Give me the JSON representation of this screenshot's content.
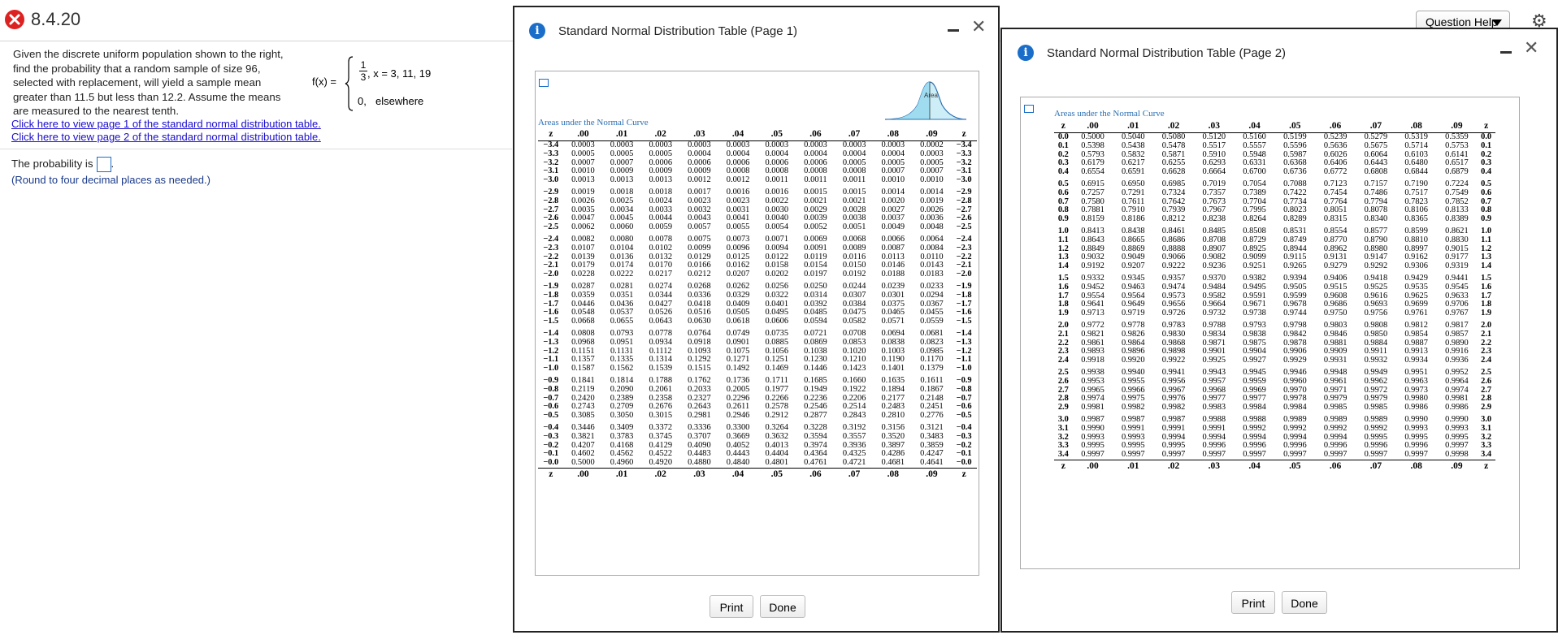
{
  "header": {
    "question_number": "8.4.20",
    "question_help_label": "Question Help"
  },
  "question": {
    "text": "Given the discrete uniform population shown to the right, find the probability that a random sample of size 96, selected with replacement, will yield a sample mean greater than 11.5 but less than 12.2. Assume the means are measured to the nearest tenth.",
    "fx_label": "f(x) =",
    "frac_num": "1",
    "frac_den": "3",
    "case1_condition": ", x = 3, 11, 19",
    "case2_value": "0,",
    "case2_condition": "elsewhere",
    "link1": "Click here to view page 1 of the standard normal distribution table.",
    "link2": "Click here to view page 2 of the standard normal distribution table.",
    "answer_prefix": "The probability is",
    "answer_suffix": ".",
    "round_note": "(Round to four decimal places as needed.)"
  },
  "dialog1": {
    "title": "Standard Normal Distribution Table (Page 1)",
    "areas_label": "Areas under the Normal Curve",
    "curve_label": "Area",
    "print_label": "Print",
    "done_label": "Done"
  },
  "dialog2": {
    "title": "Standard Normal Distribution Table (Page 2)",
    "areas_label": "Areas under the Normal Curve",
    "print_label": "Print",
    "done_label": "Done"
  },
  "table_cols": [
    "z",
    ".00",
    ".01",
    ".02",
    ".03",
    ".04",
    ".05",
    ".06",
    ".07",
    ".08",
    ".09",
    "z"
  ],
  "table_page1": [
    [
      "−3.4",
      "0.0003",
      "0.0003",
      "0.0003",
      "0.0003",
      "0.0003",
      "0.0003",
      "0.0003",
      "0.0003",
      "0.0003",
      "0.0002",
      "−3.4"
    ],
    [
      "−3.3",
      "0.0005",
      "0.0005",
      "0.0005",
      "0.0004",
      "0.0004",
      "0.0004",
      "0.0004",
      "0.0004",
      "0.0004",
      "0.0003",
      "−3.3"
    ],
    [
      "−3.2",
      "0.0007",
      "0.0007",
      "0.0006",
      "0.0006",
      "0.0006",
      "0.0006",
      "0.0006",
      "0.0005",
      "0.0005",
      "0.0005",
      "−3.2"
    ],
    [
      "−3.1",
      "0.0010",
      "0.0009",
      "0.0009",
      "0.0009",
      "0.0008",
      "0.0008",
      "0.0008",
      "0.0008",
      "0.0007",
      "0.0007",
      "−3.1"
    ],
    [
      "−3.0",
      "0.0013",
      "0.0013",
      "0.0013",
      "0.0012",
      "0.0012",
      "0.0011",
      "0.0011",
      "0.0011",
      "0.0010",
      "0.0010",
      "−3.0"
    ],
    [
      "−2.9",
      "0.0019",
      "0.0018",
      "0.0018",
      "0.0017",
      "0.0016",
      "0.0016",
      "0.0015",
      "0.0015",
      "0.0014",
      "0.0014",
      "−2.9"
    ],
    [
      "−2.8",
      "0.0026",
      "0.0025",
      "0.0024",
      "0.0023",
      "0.0023",
      "0.0022",
      "0.0021",
      "0.0021",
      "0.0020",
      "0.0019",
      "−2.8"
    ],
    [
      "−2.7",
      "0.0035",
      "0.0034",
      "0.0033",
      "0.0032",
      "0.0031",
      "0.0030",
      "0.0029",
      "0.0028",
      "0.0027",
      "0.0026",
      "−2.7"
    ],
    [
      "−2.6",
      "0.0047",
      "0.0045",
      "0.0044",
      "0.0043",
      "0.0041",
      "0.0040",
      "0.0039",
      "0.0038",
      "0.0037",
      "0.0036",
      "−2.6"
    ],
    [
      "−2.5",
      "0.0062",
      "0.0060",
      "0.0059",
      "0.0057",
      "0.0055",
      "0.0054",
      "0.0052",
      "0.0051",
      "0.0049",
      "0.0048",
      "−2.5"
    ],
    [
      "−2.4",
      "0.0082",
      "0.0080",
      "0.0078",
      "0.0075",
      "0.0073",
      "0.0071",
      "0.0069",
      "0.0068",
      "0.0066",
      "0.0064",
      "−2.4"
    ],
    [
      "−2.3",
      "0.0107",
      "0.0104",
      "0.0102",
      "0.0099",
      "0.0096",
      "0.0094",
      "0.0091",
      "0.0089",
      "0.0087",
      "0.0084",
      "−2.3"
    ],
    [
      "−2.2",
      "0.0139",
      "0.0136",
      "0.0132",
      "0.0129",
      "0.0125",
      "0.0122",
      "0.0119",
      "0.0116",
      "0.0113",
      "0.0110",
      "−2.2"
    ],
    [
      "−2.1",
      "0.0179",
      "0.0174",
      "0.0170",
      "0.0166",
      "0.0162",
      "0.0158",
      "0.0154",
      "0.0150",
      "0.0146",
      "0.0143",
      "−2.1"
    ],
    [
      "−2.0",
      "0.0228",
      "0.0222",
      "0.0217",
      "0.0212",
      "0.0207",
      "0.0202",
      "0.0197",
      "0.0192",
      "0.0188",
      "0.0183",
      "−2.0"
    ],
    [
      "−1.9",
      "0.0287",
      "0.0281",
      "0.0274",
      "0.0268",
      "0.0262",
      "0.0256",
      "0.0250",
      "0.0244",
      "0.0239",
      "0.0233",
      "−1.9"
    ],
    [
      "−1.8",
      "0.0359",
      "0.0351",
      "0.0344",
      "0.0336",
      "0.0329",
      "0.0322",
      "0.0314",
      "0.0307",
      "0.0301",
      "0.0294",
      "−1.8"
    ],
    [
      "−1.7",
      "0.0446",
      "0.0436",
      "0.0427",
      "0.0418",
      "0.0409",
      "0.0401",
      "0.0392",
      "0.0384",
      "0.0375",
      "0.0367",
      "−1.7"
    ],
    [
      "−1.6",
      "0.0548",
      "0.0537",
      "0.0526",
      "0.0516",
      "0.0505",
      "0.0495",
      "0.0485",
      "0.0475",
      "0.0465",
      "0.0455",
      "−1.6"
    ],
    [
      "−1.5",
      "0.0668",
      "0.0655",
      "0.0643",
      "0.0630",
      "0.0618",
      "0.0606",
      "0.0594",
      "0.0582",
      "0.0571",
      "0.0559",
      "−1.5"
    ],
    [
      "−1.4",
      "0.0808",
      "0.0793",
      "0.0778",
      "0.0764",
      "0.0749",
      "0.0735",
      "0.0721",
      "0.0708",
      "0.0694",
      "0.0681",
      "−1.4"
    ],
    [
      "−1.3",
      "0.0968",
      "0.0951",
      "0.0934",
      "0.0918",
      "0.0901",
      "0.0885",
      "0.0869",
      "0.0853",
      "0.0838",
      "0.0823",
      "−1.3"
    ],
    [
      "−1.2",
      "0.1151",
      "0.1131",
      "0.1112",
      "0.1093",
      "0.1075",
      "0.1056",
      "0.1038",
      "0.1020",
      "0.1003",
      "0.0985",
      "−1.2"
    ],
    [
      "−1.1",
      "0.1357",
      "0.1335",
      "0.1314",
      "0.1292",
      "0.1271",
      "0.1251",
      "0.1230",
      "0.1210",
      "0.1190",
      "0.1170",
      "−1.1"
    ],
    [
      "−1.0",
      "0.1587",
      "0.1562",
      "0.1539",
      "0.1515",
      "0.1492",
      "0.1469",
      "0.1446",
      "0.1423",
      "0.1401",
      "0.1379",
      "−1.0"
    ],
    [
      "−0.9",
      "0.1841",
      "0.1814",
      "0.1788",
      "0.1762",
      "0.1736",
      "0.1711",
      "0.1685",
      "0.1660",
      "0.1635",
      "0.1611",
      "−0.9"
    ],
    [
      "−0.8",
      "0.2119",
      "0.2090",
      "0.2061",
      "0.2033",
      "0.2005",
      "0.1977",
      "0.1949",
      "0.1922",
      "0.1894",
      "0.1867",
      "−0.8"
    ],
    [
      "−0.7",
      "0.2420",
      "0.2389",
      "0.2358",
      "0.2327",
      "0.2296",
      "0.2266",
      "0.2236",
      "0.2206",
      "0.2177",
      "0.2148",
      "−0.7"
    ],
    [
      "−0.6",
      "0.2743",
      "0.2709",
      "0.2676",
      "0.2643",
      "0.2611",
      "0.2578",
      "0.2546",
      "0.2514",
      "0.2483",
      "0.2451",
      "−0.6"
    ],
    [
      "−0.5",
      "0.3085",
      "0.3050",
      "0.3015",
      "0.2981",
      "0.2946",
      "0.2912",
      "0.2877",
      "0.2843",
      "0.2810",
      "0.2776",
      "−0.5"
    ],
    [
      "−0.4",
      "0.3446",
      "0.3409",
      "0.3372",
      "0.3336",
      "0.3300",
      "0.3264",
      "0.3228",
      "0.3192",
      "0.3156",
      "0.3121",
      "−0.4"
    ],
    [
      "−0.3",
      "0.3821",
      "0.3783",
      "0.3745",
      "0.3707",
      "0.3669",
      "0.3632",
      "0.3594",
      "0.3557",
      "0.3520",
      "0.3483",
      "−0.3"
    ],
    [
      "−0.2",
      "0.4207",
      "0.4168",
      "0.4129",
      "0.4090",
      "0.4052",
      "0.4013",
      "0.3974",
      "0.3936",
      "0.3897",
      "0.3859",
      "−0.2"
    ],
    [
      "−0.1",
      "0.4602",
      "0.4562",
      "0.4522",
      "0.4483",
      "0.4443",
      "0.4404",
      "0.4364",
      "0.4325",
      "0.4286",
      "0.4247",
      "−0.1"
    ],
    [
      "−0.0",
      "0.5000",
      "0.4960",
      "0.4920",
      "0.4880",
      "0.4840",
      "0.4801",
      "0.4761",
      "0.4721",
      "0.4681",
      "0.4641",
      "−0.0"
    ]
  ],
  "table_page2": [
    [
      "0.0",
      "0.5000",
      "0.5040",
      "0.5080",
      "0.5120",
      "0.5160",
      "0.5199",
      "0.5239",
      "0.5279",
      "0.5319",
      "0.5359",
      "0.0"
    ],
    [
      "0.1",
      "0.5398",
      "0.5438",
      "0.5478",
      "0.5517",
      "0.5557",
      "0.5596",
      "0.5636",
      "0.5675",
      "0.5714",
      "0.5753",
      "0.1"
    ],
    [
      "0.2",
      "0.5793",
      "0.5832",
      "0.5871",
      "0.5910",
      "0.5948",
      "0.5987",
      "0.6026",
      "0.6064",
      "0.6103",
      "0.6141",
      "0.2"
    ],
    [
      "0.3",
      "0.6179",
      "0.6217",
      "0.6255",
      "0.6293",
      "0.6331",
      "0.6368",
      "0.6406",
      "0.6443",
      "0.6480",
      "0.6517",
      "0.3"
    ],
    [
      "0.4",
      "0.6554",
      "0.6591",
      "0.6628",
      "0.6664",
      "0.6700",
      "0.6736",
      "0.6772",
      "0.6808",
      "0.6844",
      "0.6879",
      "0.4"
    ],
    [
      "0.5",
      "0.6915",
      "0.6950",
      "0.6985",
      "0.7019",
      "0.7054",
      "0.7088",
      "0.7123",
      "0.7157",
      "0.7190",
      "0.7224",
      "0.5"
    ],
    [
      "0.6",
      "0.7257",
      "0.7291",
      "0.7324",
      "0.7357",
      "0.7389",
      "0.7422",
      "0.7454",
      "0.7486",
      "0.7517",
      "0.7549",
      "0.6"
    ],
    [
      "0.7",
      "0.7580",
      "0.7611",
      "0.7642",
      "0.7673",
      "0.7704",
      "0.7734",
      "0.7764",
      "0.7794",
      "0.7823",
      "0.7852",
      "0.7"
    ],
    [
      "0.8",
      "0.7881",
      "0.7910",
      "0.7939",
      "0.7967",
      "0.7995",
      "0.8023",
      "0.8051",
      "0.8078",
      "0.8106",
      "0.8133",
      "0.8"
    ],
    [
      "0.9",
      "0.8159",
      "0.8186",
      "0.8212",
      "0.8238",
      "0.8264",
      "0.8289",
      "0.8315",
      "0.8340",
      "0.8365",
      "0.8389",
      "0.9"
    ],
    [
      "1.0",
      "0.8413",
      "0.8438",
      "0.8461",
      "0.8485",
      "0.8508",
      "0.8531",
      "0.8554",
      "0.8577",
      "0.8599",
      "0.8621",
      "1.0"
    ],
    [
      "1.1",
      "0.8643",
      "0.8665",
      "0.8686",
      "0.8708",
      "0.8729",
      "0.8749",
      "0.8770",
      "0.8790",
      "0.8810",
      "0.8830",
      "1.1"
    ],
    [
      "1.2",
      "0.8849",
      "0.8869",
      "0.8888",
      "0.8907",
      "0.8925",
      "0.8944",
      "0.8962",
      "0.8980",
      "0.8997",
      "0.9015",
      "1.2"
    ],
    [
      "1.3",
      "0.9032",
      "0.9049",
      "0.9066",
      "0.9082",
      "0.9099",
      "0.9115",
      "0.9131",
      "0.9147",
      "0.9162",
      "0.9177",
      "1.3"
    ],
    [
      "1.4",
      "0.9192",
      "0.9207",
      "0.9222",
      "0.9236",
      "0.9251",
      "0.9265",
      "0.9279",
      "0.9292",
      "0.9306",
      "0.9319",
      "1.4"
    ],
    [
      "1.5",
      "0.9332",
      "0.9345",
      "0.9357",
      "0.9370",
      "0.9382",
      "0.9394",
      "0.9406",
      "0.9418",
      "0.9429",
      "0.9441",
      "1.5"
    ],
    [
      "1.6",
      "0.9452",
      "0.9463",
      "0.9474",
      "0.9484",
      "0.9495",
      "0.9505",
      "0.9515",
      "0.9525",
      "0.9535",
      "0.9545",
      "1.6"
    ],
    [
      "1.7",
      "0.9554",
      "0.9564",
      "0.9573",
      "0.9582",
      "0.9591",
      "0.9599",
      "0.9608",
      "0.9616",
      "0.9625",
      "0.9633",
      "1.7"
    ],
    [
      "1.8",
      "0.9641",
      "0.9649",
      "0.9656",
      "0.9664",
      "0.9671",
      "0.9678",
      "0.9686",
      "0.9693",
      "0.9699",
      "0.9706",
      "1.8"
    ],
    [
      "1.9",
      "0.9713",
      "0.9719",
      "0.9726",
      "0.9732",
      "0.9738",
      "0.9744",
      "0.9750",
      "0.9756",
      "0.9761",
      "0.9767",
      "1.9"
    ],
    [
      "2.0",
      "0.9772",
      "0.9778",
      "0.9783",
      "0.9788",
      "0.9793",
      "0.9798",
      "0.9803",
      "0.9808",
      "0.9812",
      "0.9817",
      "2.0"
    ],
    [
      "2.1",
      "0.9821",
      "0.9826",
      "0.9830",
      "0.9834",
      "0.9838",
      "0.9842",
      "0.9846",
      "0.9850",
      "0.9854",
      "0.9857",
      "2.1"
    ],
    [
      "2.2",
      "0.9861",
      "0.9864",
      "0.9868",
      "0.9871",
      "0.9875",
      "0.9878",
      "0.9881",
      "0.9884",
      "0.9887",
      "0.9890",
      "2.2"
    ],
    [
      "2.3",
      "0.9893",
      "0.9896",
      "0.9898",
      "0.9901",
      "0.9904",
      "0.9906",
      "0.9909",
      "0.9911",
      "0.9913",
      "0.9916",
      "2.3"
    ],
    [
      "2.4",
      "0.9918",
      "0.9920",
      "0.9922",
      "0.9925",
      "0.9927",
      "0.9929",
      "0.9931",
      "0.9932",
      "0.9934",
      "0.9936",
      "2.4"
    ],
    [
      "2.5",
      "0.9938",
      "0.9940",
      "0.9941",
      "0.9943",
      "0.9945",
      "0.9946",
      "0.9948",
      "0.9949",
      "0.9951",
      "0.9952",
      "2.5"
    ],
    [
      "2.6",
      "0.9953",
      "0.9955",
      "0.9956",
      "0.9957",
      "0.9959",
      "0.9960",
      "0.9961",
      "0.9962",
      "0.9963",
      "0.9964",
      "2.6"
    ],
    [
      "2.7",
      "0.9965",
      "0.9966",
      "0.9967",
      "0.9968",
      "0.9969",
      "0.9970",
      "0.9971",
      "0.9972",
      "0.9973",
      "0.9974",
      "2.7"
    ],
    [
      "2.8",
      "0.9974",
      "0.9975",
      "0.9976",
      "0.9977",
      "0.9977",
      "0.9978",
      "0.9979",
      "0.9979",
      "0.9980",
      "0.9981",
      "2.8"
    ],
    [
      "2.9",
      "0.9981",
      "0.9982",
      "0.9982",
      "0.9983",
      "0.9984",
      "0.9984",
      "0.9985",
      "0.9985",
      "0.9986",
      "0.9986",
      "2.9"
    ],
    [
      "3.0",
      "0.9987",
      "0.9987",
      "0.9987",
      "0.9988",
      "0.9988",
      "0.9989",
      "0.9989",
      "0.9989",
      "0.9990",
      "0.9990",
      "3.0"
    ],
    [
      "3.1",
      "0.9990",
      "0.9991",
      "0.9991",
      "0.9991",
      "0.9992",
      "0.9992",
      "0.9992",
      "0.9992",
      "0.9993",
      "0.9993",
      "3.1"
    ],
    [
      "3.2",
      "0.9993",
      "0.9993",
      "0.9994",
      "0.9994",
      "0.9994",
      "0.9994",
      "0.9994",
      "0.9995",
      "0.9995",
      "0.9995",
      "3.2"
    ],
    [
      "3.3",
      "0.9995",
      "0.9995",
      "0.9995",
      "0.9996",
      "0.9996",
      "0.9996",
      "0.9996",
      "0.9996",
      "0.9996",
      "0.9997",
      "3.3"
    ],
    [
      "3.4",
      "0.9997",
      "0.9997",
      "0.9997",
      "0.9997",
      "0.9997",
      "0.9997",
      "0.9997",
      "0.9997",
      "0.9997",
      "0.9998",
      "3.4"
    ]
  ]
}
